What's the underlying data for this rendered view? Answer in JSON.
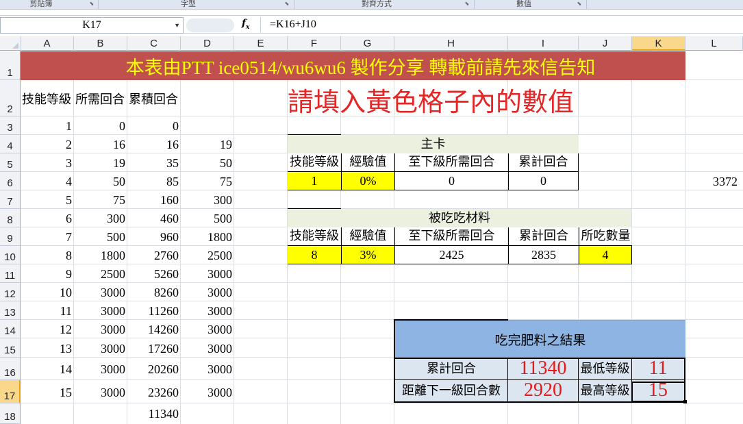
{
  "ribbon": {
    "groups": [
      "剪貼簿",
      "字型",
      "對齊方式",
      "數值"
    ]
  },
  "formula_bar": {
    "name_box": "K17",
    "fx_label": "fx",
    "formula": "=K16+J10"
  },
  "columns": [
    "A",
    "B",
    "C",
    "D",
    "E",
    "F",
    "G",
    "H",
    "I",
    "J",
    "K",
    "L"
  ],
  "selected_column": "K",
  "rows": [
    "1",
    "2",
    "3",
    "4",
    "5",
    "6",
    "7",
    "8",
    "9",
    "10",
    "11",
    "12",
    "13",
    "14",
    "15",
    "16",
    "17",
    "18"
  ],
  "selected_row": "17",
  "banner": "本表由PTT ice0514/wu6wu6 製作分享 轉載前請先來信告知",
  "instruction": "請填入黃色格子內的數值",
  "table_headers": {
    "level": "技能等級",
    "need": "所需回合",
    "cumulative": "累積回合"
  },
  "level_table": [
    {
      "a": "1",
      "b": "0",
      "c": "0",
      "d": ""
    },
    {
      "a": "2",
      "b": "16",
      "c": "16",
      "d": "19"
    },
    {
      "a": "3",
      "b": "19",
      "c": "35",
      "d": "50"
    },
    {
      "a": "4",
      "b": "50",
      "c": "85",
      "d": "75"
    },
    {
      "a": "5",
      "b": "75",
      "c": "160",
      "d": "300"
    },
    {
      "a": "6",
      "b": "300",
      "c": "460",
      "d": "500"
    },
    {
      "a": "7",
      "b": "500",
      "c": "960",
      "d": "1800"
    },
    {
      "a": "8",
      "b": "1800",
      "c": "2760",
      "d": "2500"
    },
    {
      "a": "9",
      "b": "2500",
      "c": "5260",
      "d": "3000"
    },
    {
      "a": "10",
      "b": "3000",
      "c": "8260",
      "d": "3000"
    },
    {
      "a": "11",
      "b": "3000",
      "c": "11260",
      "d": "3000"
    },
    {
      "a": "12",
      "b": "3000",
      "c": "14260",
      "d": "3000"
    },
    {
      "a": "13",
      "b": "3000",
      "c": "17260",
      "d": "3000"
    },
    {
      "a": "14",
      "b": "3000",
      "c": "20260",
      "d": "3000"
    },
    {
      "a": "15",
      "b": "3000",
      "c": "23260",
      "d": "3000"
    },
    {
      "a": "",
      "b": "",
      "c": "11340",
      "d": ""
    }
  ],
  "main_card": {
    "title": "主卡",
    "headers": [
      "技能等級",
      "經驗值",
      "至下級所需回合",
      "累計回合"
    ],
    "values": [
      "1",
      "0%",
      "0",
      "0"
    ]
  },
  "l6_value": "3372",
  "material": {
    "title": "被吃吃材料",
    "headers": [
      "技能等級",
      "經驗值",
      "至下級所需回合",
      "累計回合",
      "所吃數量"
    ],
    "values": [
      "8",
      "3%",
      "2425",
      "2835",
      "4"
    ]
  },
  "result": {
    "title": "吃完肥料之結果",
    "cum_label": "累計回合",
    "cum_value": "11340",
    "min_label": "最低等級",
    "min_value": "11",
    "next_label": "距離下一級回合數",
    "next_value": "2920",
    "max_label": "最高等級",
    "max_value": "15"
  },
  "colors": {
    "banner_bg": "#c0504d",
    "banner_text": "#ffff00",
    "instruction": "#e52626",
    "yellow_input": "#ffff00",
    "result_header": "#8db4e2",
    "result_cells": "#dce6f1",
    "result_numbers": "#e51919"
  }
}
